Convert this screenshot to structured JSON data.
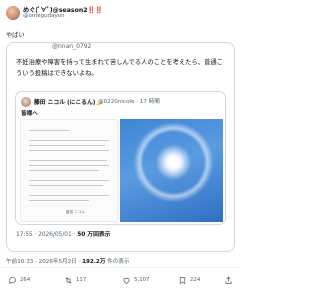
{
  "post": {
    "author_name": "めぐ(ﾟ∀ﾟ)@season2‼️‼️",
    "author_handle": "@omegudayon",
    "text": "やばい"
  },
  "quote": {
    "handle_top": "@nnan_0792",
    "text": "不妊治療や障害を持って生まれて苦しんでる人のことを考えたら、普通こういう投稿はできないよね。",
    "meta_time": "17:55 · 2026/05/01 · ",
    "meta_views": "50 万回表示"
  },
  "inner": {
    "name": "藤田 ニコル (にこるん)🌙",
    "handle": "@0220nicole · 17 時間",
    "subtitle": "皆様へ",
    "signature": "藤田 ニコル"
  },
  "footer": {
    "time": "午前10:33 · 2026年5月2日 · ",
    "views": "192.2万",
    "views_suffix": " 件の表示"
  },
  "actions": {
    "reply_count": "264",
    "retweet_count": "117",
    "like_count": "5,107",
    "bookmark_count": "224"
  },
  "colors": {
    "text": "#0f1419",
    "secondary": "#536471",
    "border": "#cfd9de",
    "sky_blue": "#3e86d6"
  }
}
